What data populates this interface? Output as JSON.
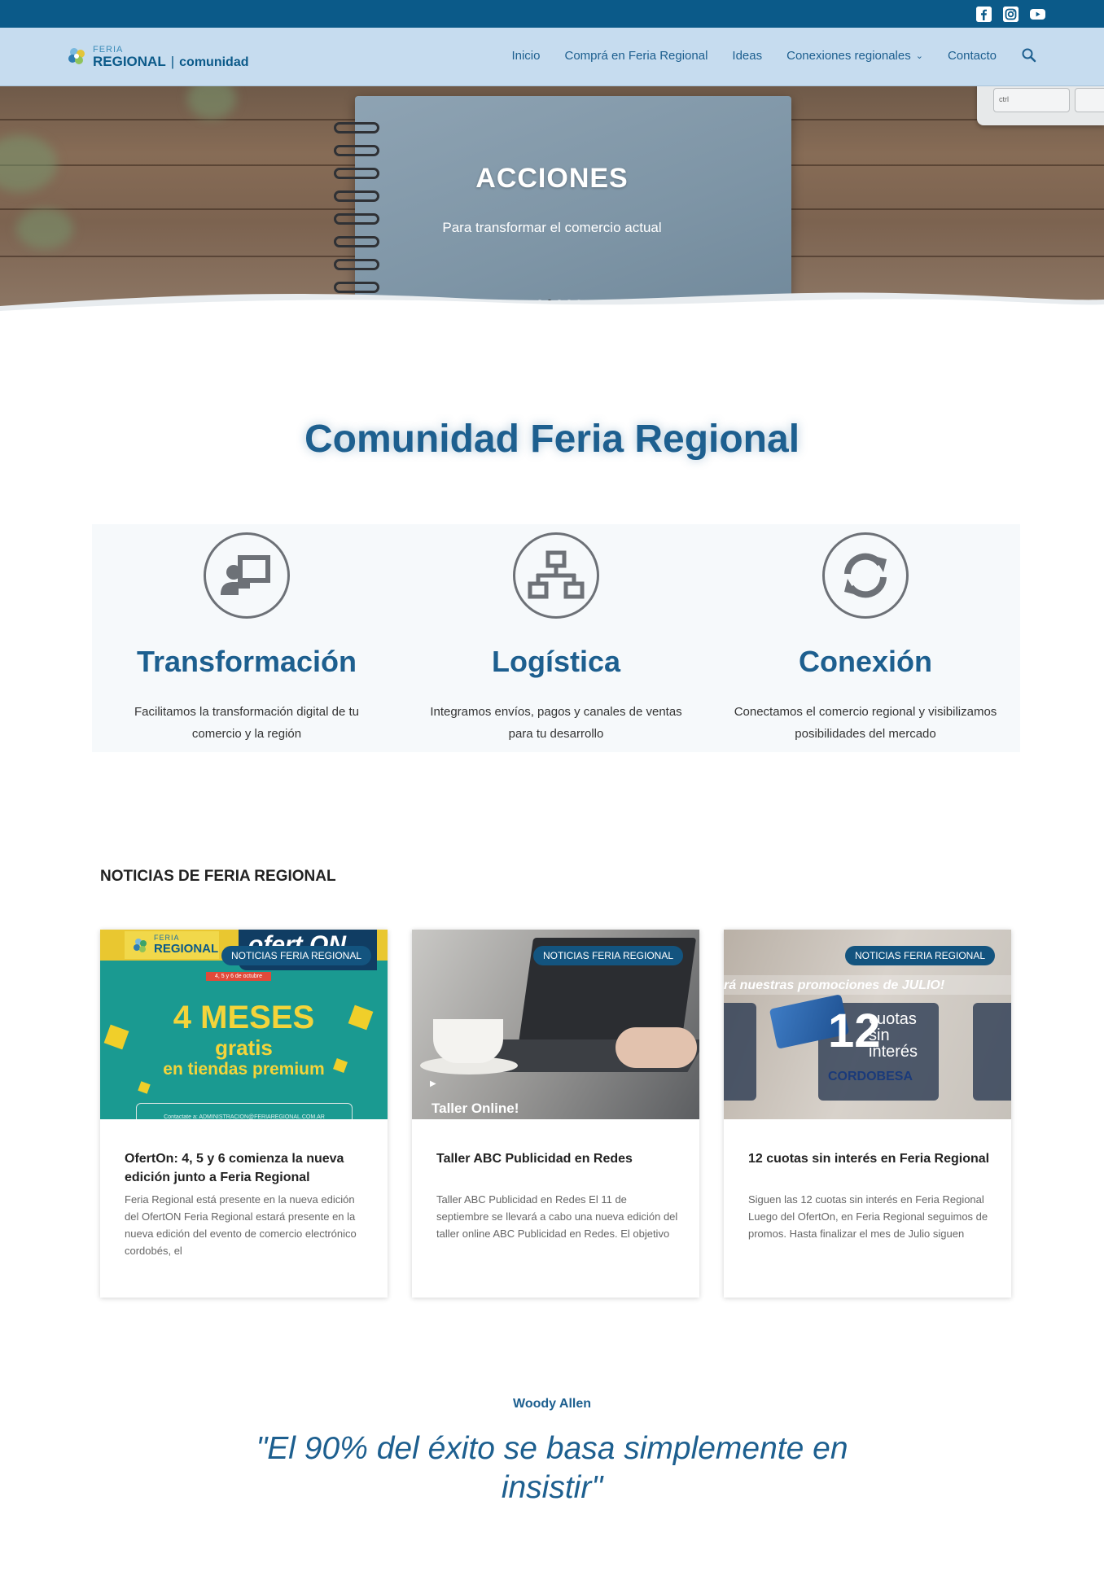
{
  "social": {
    "icons": [
      "facebook-icon",
      "instagram-icon",
      "youtube-icon"
    ]
  },
  "header": {
    "logo": {
      "feria": "FERIA",
      "regional": "REGIONAL",
      "separator": "|",
      "comunidad": "comunidad"
    },
    "nav": {
      "inicio": "Inicio",
      "compra": "Comprá en Feria Regional",
      "ideas": "Ideas",
      "conexiones": "Conexiones regionales",
      "contacto": "Contacto"
    }
  },
  "hero": {
    "title": "ACCIONES",
    "subtitle": "Para transformar el comercio actual",
    "keyboard_key": "ctrl"
  },
  "section": {
    "title": "Comunidad Feria Regional"
  },
  "features": [
    {
      "icon": "presentation-icon",
      "title": "Transformación",
      "desc": "Facilitamos la transformación digital de tu comercio y la región"
    },
    {
      "icon": "network-icon",
      "title": "Logística",
      "desc": "Integramos envíos, pagos y canales de ventas para tu desarrollo"
    },
    {
      "icon": "sync-icon",
      "title": "Conexión",
      "desc": "Conectamos el comercio regional y visibilizamos posibilidades del mercado"
    }
  ],
  "news": {
    "heading": "NOTICIAS DE FERIA REGIONAL",
    "cards": [
      {
        "badge": "NOTICIAS FERIA REGIONAL",
        "title": "OfertOn: 4, 5 y 6 comienza la nueva edición junto a Feria Regional",
        "excerpt": "Feria Regional está presente en la nueva edición del OfertON Feria Regional estará presente en la nueva edición del evento de comercio electrónico cordobés, el",
        "image": {
          "logo_feria": "FERIA",
          "logo_regional": "REGIONAL",
          "ofert": "ofert ON",
          "dates": "4, 5 y 6 de octubre",
          "line1": "4 MESES",
          "line2": "gratis",
          "line3": "en tiendas premium",
          "bottom": "Contactate a: ADMINISTRACION@FERIAREGIONAL.COM.AR"
        }
      },
      {
        "badge": "NOTICIAS FERIA REGIONAL",
        "title": "Taller ABC Publicidad en Redes",
        "excerpt": "Taller ABC Publicidad en Redes El 11 de septiembre se llevará a cabo una nueva edición del taller online ABC Publicidad en Redes.  El objetivo",
        "image": {
          "caption": "Taller Online!"
        }
      },
      {
        "badge": "NOTICIAS FERIA REGIONAL",
        "title": "12 cuotas sin interés en Feria Regional",
        "excerpt": "Siguen las 12 cuotas sin interés en Feria Regional Luego del OfertOn, en Feria Regional seguimos de promos. Hasta finalizar el mes de Julio siguen",
        "image": {
          "banner": "rá nuestras promociones de JULIO!",
          "number": "12",
          "cuotas": "cuotas sin interés",
          "brand": "CORDOBESA"
        }
      }
    ]
  },
  "quote": {
    "author": "Woody Allen",
    "text": "\"El 90% del éxito se basa simplemente en insistir\""
  },
  "colors": {
    "topbar": "#0b5a89",
    "header": "#c6dcef",
    "accent": "#1d5f8f",
    "badge": "#13547f"
  }
}
